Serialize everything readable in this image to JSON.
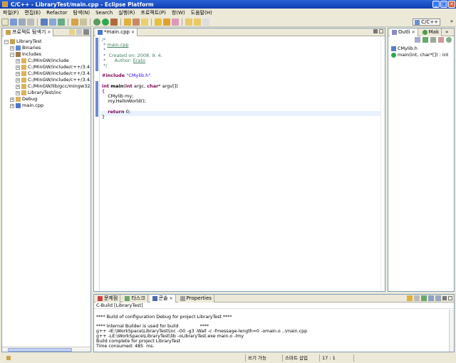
{
  "window": {
    "title": "C/C++ - LibraryTest/main.cpp - Eclipse Platform",
    "buttons": {
      "minimize": "_",
      "maximize": "□",
      "close": "✕"
    }
  },
  "menu": [
    "파일(F)",
    "편집(E)",
    "Refactor",
    "탐색(N)",
    "Search",
    "실행(R)",
    "프로젝트(P)",
    "창(W)",
    "도움말(H)"
  ],
  "toolbar": {
    "perspective_label": "C/C++",
    "more": "»"
  },
  "explorer": {
    "tab_label": "프로젝트 탐색기",
    "close": "✕",
    "tree": [
      {
        "depth": 0,
        "expander": "−",
        "label": "LibraryTest",
        "icon": "project-icon"
      },
      {
        "depth": 1,
        "expander": "+",
        "label": "Binaries",
        "icon": "binaries-icon"
      },
      {
        "depth": 1,
        "expander": "−",
        "label": "Includes",
        "icon": "includes-icon"
      },
      {
        "depth": 2,
        "expander": "+",
        "label": "C:/MinGW/include",
        "icon": "folder-icon"
      },
      {
        "depth": 2,
        "expander": "+",
        "label": "C:/MinGW/include/c++/3.4.5",
        "icon": "folder-icon"
      },
      {
        "depth": 2,
        "expander": "+",
        "label": "C:/MinGW/include/c++/3.4.5",
        "icon": "folder-icon"
      },
      {
        "depth": 2,
        "expander": "+",
        "label": "C:/MinGW/include/c++/3.4.5",
        "icon": "folder-icon"
      },
      {
        "depth": 2,
        "expander": "+",
        "label": "C:/MinGW/lib/gcc/mingw32/",
        "icon": "folder-icon"
      },
      {
        "depth": 2,
        "expander": "+",
        "label": "LibraryTest/inc",
        "icon": "folder-icon"
      },
      {
        "depth": 1,
        "expander": "+",
        "label": "Debug",
        "icon": "folder-icon"
      },
      {
        "depth": 1,
        "expander": "+",
        "label": "main.cpp",
        "icon": "cpp-file-icon"
      }
    ]
  },
  "editor": {
    "tab_label": "*main.cpp",
    "close": "✕",
    "lines": [
      [
        {
          "t": "/*",
          "c": "cmt"
        }
      ],
      [
        {
          "t": " * ",
          "c": "cmt"
        },
        {
          "t": "main.cpp",
          "c": "link"
        }
      ],
      [
        {
          "t": " *",
          "c": "cmt"
        }
      ],
      [
        {
          "t": " *  Created on: 2008. 9. 4.",
          "c": "cmt"
        }
      ],
      [
        {
          "t": " *      Author: ",
          "c": "cmt"
        },
        {
          "t": "Erato",
          "c": "link"
        }
      ],
      [
        {
          "t": " */",
          "c": "cmt"
        }
      ],
      [
        {
          "t": "",
          "c": ""
        }
      ],
      [
        {
          "t": "#include ",
          "c": "kw"
        },
        {
          "t": "\"CMylib.h\"",
          "c": "str"
        }
      ],
      [
        {
          "t": "",
          "c": ""
        }
      ],
      [
        {
          "t": "int ",
          "c": "kw"
        },
        {
          "t": "main",
          "c": "b"
        },
        {
          "t": "(",
          "c": ""
        },
        {
          "t": "int",
          "c": "kw"
        },
        {
          "t": " argc, ",
          "c": ""
        },
        {
          "t": "char",
          "c": "kw"
        },
        {
          "t": "* argv[])",
          "c": ""
        }
      ],
      [
        {
          "t": "{",
          "c": ""
        }
      ],
      [
        {
          "t": "    CMylib my;",
          "c": ""
        }
      ],
      [
        {
          "t": "    my.HelloWorld();",
          "c": ""
        }
      ],
      [
        {
          "t": "",
          "c": ""
        }
      ],
      [
        {
          "t": "    ",
          "c": ""
        },
        {
          "t": "return ",
          "c": "kw"
        },
        {
          "t": "0;",
          "c": ""
        }
      ],
      [
        {
          "t": "}",
          "c": ""
        }
      ],
      [
        {
          "t": "",
          "c": ""
        }
      ]
    ]
  },
  "outline": {
    "tabs": [
      "Outli",
      "Mak"
    ],
    "close": "✕",
    "more": "»",
    "items": [
      {
        "label": "CMylib.h",
        "icon": "header-include-icon"
      },
      {
        "label": "main(int, char*[]) : int",
        "icon": "function-icon"
      }
    ]
  },
  "bottom": {
    "tabs": [
      "문제점",
      "타스크",
      "콘솔",
      "Properties"
    ],
    "close": "✕",
    "console_title": "C-Build [LibraryTest]",
    "console_lines": [
      "",
      "**** Build of configuration Debug for project LibraryTest ****",
      "",
      "**** Internal Builder is used for build               ****",
      "g++ -IE:\\WorkSpace\\LibraryTest\\inc -O0 -g3 -Wall -c -fmessage-length=0 -omain.o ..\\main.cpp",
      "g++ -LE:\\WorkSpace\\LibraryTest\\lib -oLibraryTest.exe main.o -lmy",
      "Build complete for project LibraryTest",
      "Time consumed: 485  ms."
    ]
  },
  "status": {
    "writable": "쓰기 가능",
    "insert_mode": "스마트 삽입",
    "position": "17 : 1"
  },
  "colors": {
    "title_bar": "#0d3fb0",
    "keyword": "#7f0055",
    "comment": "#3f7f5f",
    "string": "#2a00ff"
  }
}
